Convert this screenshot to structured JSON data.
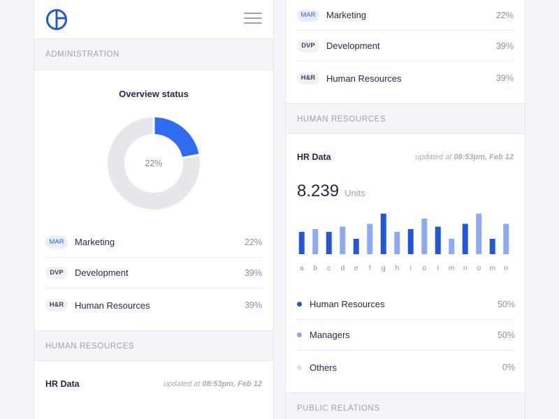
{
  "left": {
    "section1": "ADMINISTRATION",
    "overview_title": "Overview status",
    "donut": {
      "percent_label": "22%",
      "fraction": 0.22,
      "fill_color": "#2f6cf0",
      "track_color": "#e6e7eb"
    },
    "items": [
      {
        "tag": "MAR",
        "label": "Marketing",
        "value": "22%",
        "tag_style": "blue"
      },
      {
        "tag": "DVP",
        "label": "Development",
        "value": "39%",
        "tag_style": "plain"
      },
      {
        "tag": "H&R",
        "label": "Human Resources",
        "value": "39%",
        "tag_style": "plain"
      }
    ],
    "section2": "HUMAN RESOURCES",
    "hr": {
      "title": "HR Data",
      "updated_prefix": "updated at",
      "updated_value": "08:53pm, Feb 12"
    }
  },
  "right": {
    "items": [
      {
        "tag": "MAR",
        "label": "Marketing",
        "value": "22%",
        "tag_style": "blue"
      },
      {
        "tag": "DVP",
        "label": "Development",
        "value": "39%",
        "tag_style": "plain"
      },
      {
        "tag": "H&R",
        "label": "Human Resources",
        "value": "39%",
        "tag_style": "plain"
      }
    ],
    "section1": "HUMAN RESOURCES",
    "hr": {
      "title": "HR Data",
      "updated_prefix": "updated at",
      "updated_value": "08:53pm, Feb 12",
      "big_value": "8.239",
      "big_unit": "Units"
    },
    "chart_data": {
      "type": "bar",
      "categories": [
        "a",
        "b",
        "c",
        "d",
        "e",
        "f",
        "g",
        "h",
        "i",
        "o",
        "l",
        "m",
        "n",
        "o",
        "m",
        "n"
      ],
      "values": [
        0.55,
        0.62,
        0.55,
        0.68,
        0.38,
        0.75,
        1.0,
        0.55,
        0.62,
        0.88,
        0.68,
        0.38,
        0.75,
        1.0,
        0.38,
        0.75
      ],
      "colors": [
        "dark",
        "light",
        "dark",
        "light",
        "dark",
        "light",
        "dark",
        "light",
        "dark",
        "light",
        "dark",
        "light",
        "dark",
        "light",
        "dark",
        "light"
      ]
    },
    "legend": [
      {
        "label": "Human Resources",
        "value": "50%",
        "color": "#2457d6"
      },
      {
        "label": "Managers",
        "value": "50%",
        "color": "#86a8ec"
      },
      {
        "label": "Others",
        "value": "0%",
        "color": "#e1e3e8"
      }
    ],
    "section2": "PUBLIC RELATIONS"
  },
  "colors": {
    "dark_bar": "#2457d6",
    "light_bar": "#8daaf0",
    "accent": "#2f6cf0"
  }
}
